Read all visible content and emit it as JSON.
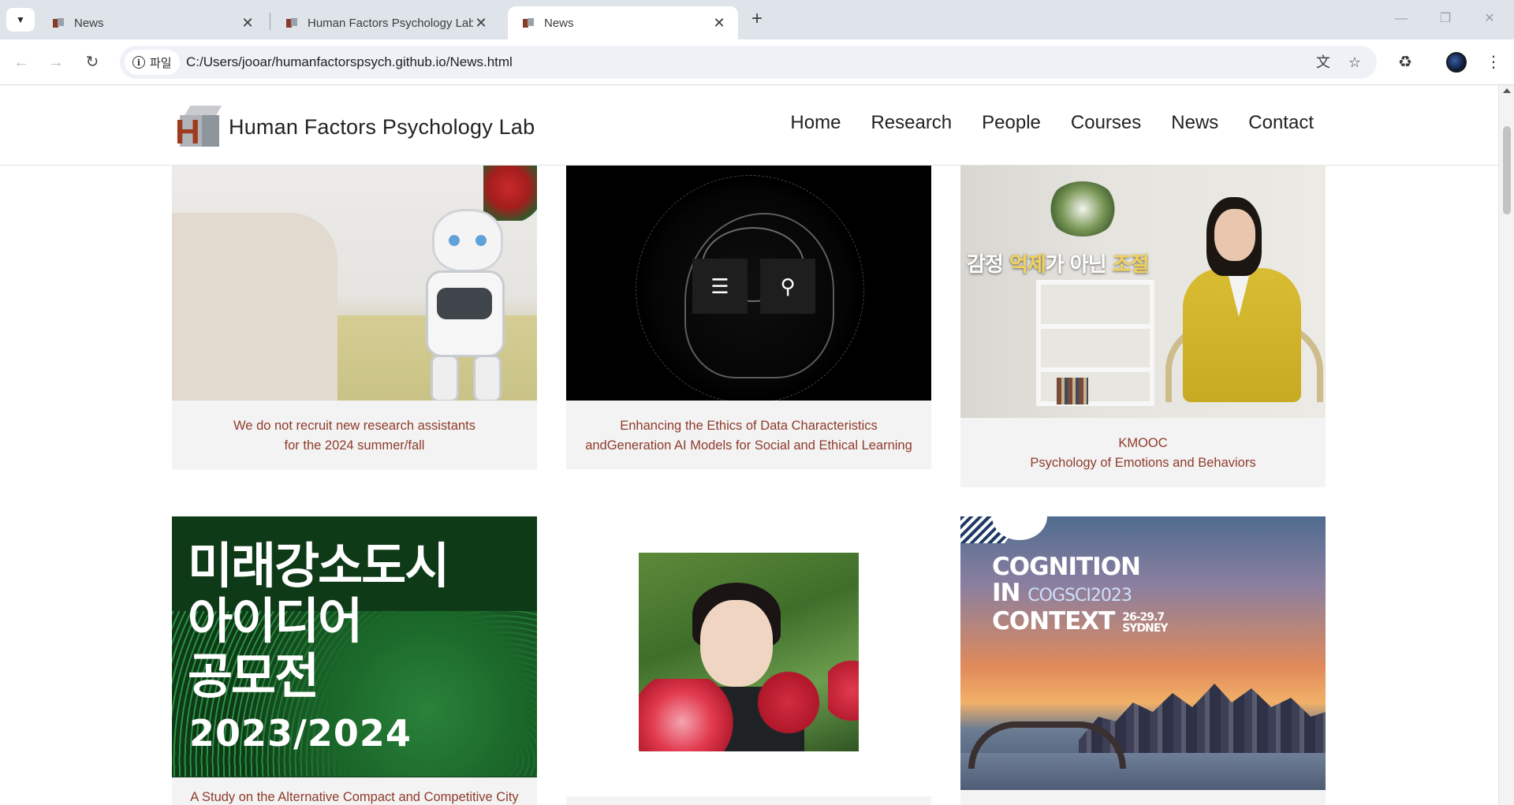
{
  "browser": {
    "tabs": [
      {
        "title": "News",
        "active": false
      },
      {
        "title": "Human Factors Psychology Lab",
        "active": false
      },
      {
        "title": "News",
        "active": true
      }
    ],
    "new_tab_symbol": "+",
    "site_chip_label": "파일",
    "url": "C:/Users/jooar/humanfactorspsych.github.io/News.html",
    "icons": [
      "tab-search-icon",
      "back-icon",
      "forward-icon",
      "reload-icon",
      "info-icon",
      "translate-icon",
      "bookmark-star-icon",
      "extensions-icon",
      "profile-avatar",
      "menu-dots-icon",
      "minimize-icon",
      "maximize-icon",
      "close-icon"
    ]
  },
  "site": {
    "logo_text": "Human Factors Psychology Lab",
    "nav": [
      "Home",
      "Research",
      "People",
      "Courses",
      "News",
      "Contact"
    ]
  },
  "news": [
    {
      "caption_line1": "We do not recruit new research assistants",
      "caption_line2": "for the 2024 summer/fall",
      "image": "robot-hand-shake"
    },
    {
      "caption_line1": "Enhancing the Ethics of Data Characteristics",
      "caption_line2": "andGeneration AI Models for Social and Ethical Learning",
      "image": "network-brain",
      "overlay_icons": [
        "list-icon",
        "search-icon"
      ]
    },
    {
      "caption_line1": "KMOOC",
      "caption_line2": "Psychology of Emotions and Behaviors",
      "image": "lecturer-video",
      "image_text": {
        "part1": "감정 ",
        "part2": "억제",
        "part3": "가 아닌 ",
        "part4": "조절"
      }
    },
    {
      "caption_line1": "A Study on the Alternative Compact and Competitive City",
      "image": "contest-poster",
      "image_text": {
        "line1": "미래강소도시",
        "line2": "아이디어",
        "line3": "공모전",
        "year": "2023/2024"
      }
    },
    {
      "caption_line1": "",
      "image": "student-portrait-tulips"
    },
    {
      "caption_line1": "",
      "image": "cogsci-sydney",
      "image_text": {
        "line1": "COGNITION",
        "line2a": "IN ",
        "line2b": "COGSCI2023",
        "line3": "CONTEXT",
        "date": "26-29.7",
        "city": "SYDNEY"
      }
    }
  ],
  "colors": {
    "caption": "#8f3b2b",
    "card_bg": "#f3f3f3",
    "chrome_bg": "#dfe3ea"
  }
}
